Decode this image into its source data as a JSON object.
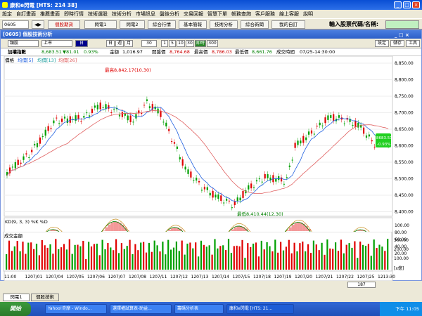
{
  "window": {
    "title": "康和e閃電 [HTS: 214 38]"
  },
  "menu": [
    "設定",
    "自訂畫面",
    "推薦畫面",
    "即時行情",
    "技術選股",
    "技術分析",
    "市場訊息",
    "盤後分析",
    "交易回報",
    "智慧下單",
    "帳務查詢",
    "客戶服務",
    "線上客服",
    "說明"
  ],
  "toolbar": {
    "code": "0605",
    "buttons": [
      "個股期貨",
      "閃電1",
      "閃電2",
      "綜合行情",
      "基本簡報",
      "技術分析",
      "綜合新聞",
      "我的自訂"
    ],
    "input_label": "輸入股票代碼/名稱:"
  },
  "panel": {
    "title": "[0605] 個股技術分析",
    "right_buttons": [
      "設定",
      "儲存",
      "工具"
    ],
    "ctrl": {
      "type": "類股",
      "market": "上市",
      "period_sel": "日",
      "periods": [
        "日",
        "週",
        "月"
      ],
      "count": "30",
      "mins": [
        "1",
        "5",
        "10",
        "30"
      ],
      "realtime": "即時",
      "n": "300"
    }
  },
  "info": {
    "name_label": "加權指數",
    "price": "8,683.51",
    "change": "▼81.01",
    "pct": "0.93%",
    "amount_label": "金額",
    "amount": "1,016.97",
    "open_label": "開盤價",
    "open": "8,764.68",
    "high_label": "最高價",
    "high": "8,786.03",
    "low_label": "最低價",
    "low": "8,661.76",
    "time_label": "成交時間",
    "time": "07/25-14:30:00"
  },
  "price_chart": {
    "legend": [
      "價格",
      "均價[5]",
      "均價[13]",
      "均價[26]"
    ],
    "annot_high": "最高8,842.17(10.30)",
    "annot_low": "最低8,410.44(12.30)",
    "last_label": "8683.51",
    "last_pct": "-0.93%",
    "y_ticks": [
      "8,850.00",
      "8,800.00",
      "8,750.00",
      "8,700.00",
      "8,650.00",
      "8,600.00",
      "8,550.00",
      "8,500.00",
      "8,450.00",
      "8,400.00"
    ]
  },
  "kd_chart": {
    "title": "KD(9, 3, 3) %K %D",
    "y_ticks": [
      "100.00",
      "80.00",
      "60.00",
      "40.00",
      "20.00"
    ]
  },
  "vol_chart": {
    "title": "成交金額",
    "y_ticks": [
      "300.00",
      "200.00",
      "100.00"
    ],
    "unit": "[x億]"
  },
  "x_axis": [
    "11:00",
    "1207/01",
    "1207/04",
    "1207/05",
    "1207/06",
    "1207/07",
    "1207/08",
    "1207/11",
    "1207/12",
    "1207/13",
    "1207/14",
    "1207/15",
    "1207/18",
    "1207/19",
    "1207/20",
    "1207/21",
    "1207/22",
    "1207/25",
    "1213:30"
  ],
  "scroll": {
    "pos": "187"
  },
  "tabs": [
    "閃電1",
    "個股技術"
  ],
  "taskbar": {
    "start": "開始",
    "tasks": [
      "Yahoo!奇摩 - Windo...",
      "選擇權試算表-助益...",
      "籌碼分析表",
      "康和e閃電 [HTS: 21..."
    ],
    "clock": "下午 11:05"
  },
  "colors": {
    "up": "#e00000",
    "down": "#00a000",
    "ma5": "#2060e0",
    "ma13": "#20a0a0",
    "ma26": "#e06060"
  }
}
